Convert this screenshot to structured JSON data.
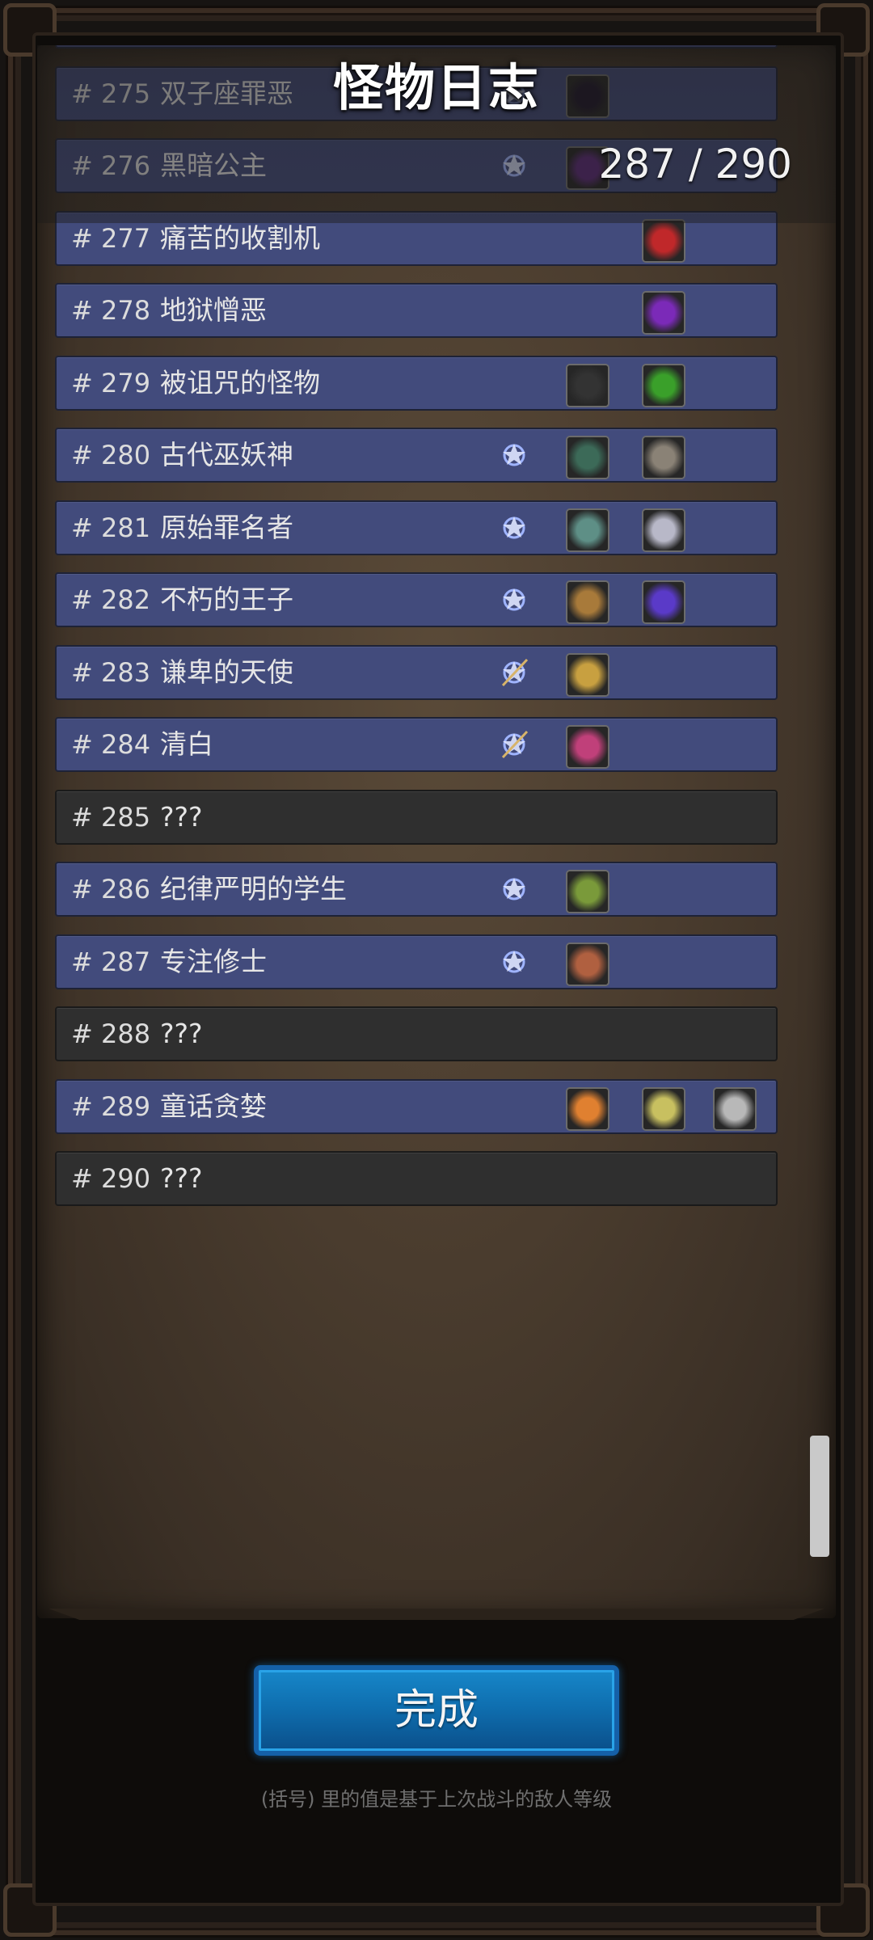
{
  "header": {
    "title": "怪物日志",
    "counter": "287 / 290"
  },
  "rows": [
    {
      "number": "#",
      "name": "",
      "star": "none",
      "items": [
        "dark-ring-icon",
        "dark-item-icon"
      ]
    },
    {
      "number": "# 275",
      "name": "双子座罪恶",
      "star": "blue-star-icon",
      "items": [
        "dark-cloak-icon"
      ]
    },
    {
      "number": "# 276",
      "name": "黑暗公主",
      "star": "blue-star-icon",
      "items": [
        "purple-boot-icon"
      ]
    },
    {
      "number": "# 277",
      "name": "痛苦的收割机",
      "star": "none",
      "items": [
        "",
        "red-rune-icon"
      ]
    },
    {
      "number": "# 278",
      "name": "地狱憎恶",
      "star": "none",
      "items": [
        "",
        "purple-rune-icon"
      ]
    },
    {
      "number": "# 279",
      "name": "被诅咒的怪物",
      "star": "none",
      "items": [
        "dark-rings-icon",
        "green-rune-icon"
      ]
    },
    {
      "number": "# 280",
      "name": "古代巫妖神",
      "star": "blue-star-icon",
      "items": [
        "green-robe-icon",
        "claw-gauntlet-icon"
      ]
    },
    {
      "number": "# 281",
      "name": "原始罪名者",
      "star": "blue-star-icon",
      "items": [
        "mace-icon",
        "armor-legs-icon"
      ]
    },
    {
      "number": "# 282",
      "name": "不朽的王子",
      "star": "blue-star-icon",
      "items": [
        "round-shield-icon",
        "purple-bracer-icon"
      ]
    },
    {
      "number": "# 283",
      "name": "谦卑的天使",
      "star": "sword-star-icon",
      "items": [
        "golden-staff-icon"
      ]
    },
    {
      "number": "# 284",
      "name": "清白",
      "star": "sword-star-icon",
      "items": [
        "pendant-icon"
      ]
    },
    {
      "number": "# 285",
      "name": "???",
      "star": "none",
      "items": [],
      "unknown": true
    },
    {
      "number": "# 286",
      "name": "纪律严明的学生",
      "star": "blue-star-icon",
      "items": [
        "necklace-icon"
      ]
    },
    {
      "number": "# 287",
      "name": "专注修士",
      "star": "blue-star-icon",
      "items": [
        "amulet-icon"
      ]
    },
    {
      "number": "# 288",
      "name": "???",
      "star": "none",
      "items": [],
      "unknown": true
    },
    {
      "number": "# 289",
      "name": "童话贪婪",
      "star": "none",
      "items": [
        "orange-gem-icon",
        "potion-vial-icon",
        "silver-coin-icon"
      ]
    },
    {
      "number": "# 290",
      "name": "???",
      "star": "none",
      "items": [],
      "unknown": true
    }
  ],
  "footer": {
    "done_label": "完成",
    "note": "(括号) 里的值是基于上次战斗的敌人等级"
  },
  "colors": {
    "row_known": "#424b7c",
    "row_unknown": "#2f2f2f",
    "button": "#1787c9"
  }
}
